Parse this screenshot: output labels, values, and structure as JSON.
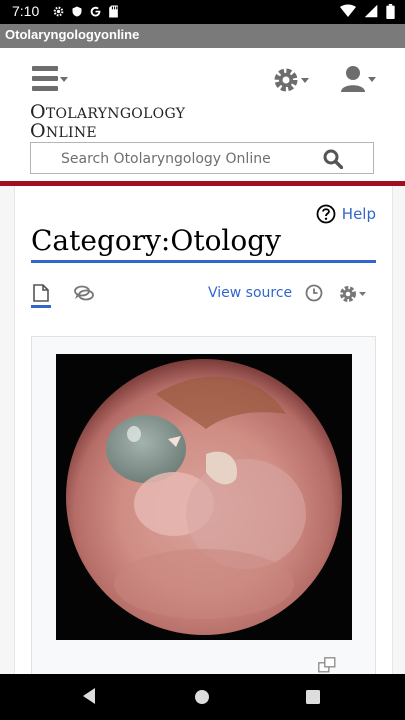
{
  "status_bar": {
    "time": "7:10"
  },
  "app_bar": {
    "title": "Otolaryngologyonline"
  },
  "site": {
    "logo_line1_cap": "O",
    "logo_line1_rest": "TOLARYNGOLOGY",
    "logo_line2_cap": "O",
    "logo_line2_rest": "NLINE",
    "search_placeholder": "Search Otolaryngology Online"
  },
  "page": {
    "help_label": "Help",
    "title": "Category:Otology",
    "view_source_label": "View source"
  },
  "colors": {
    "accent": "#3366cc",
    "brand_rule": "#a00f1e",
    "appbar": "#7a7a7a"
  },
  "icons": [
    "menu-icon",
    "gear-icon",
    "user-icon",
    "search-icon",
    "help-icon",
    "page-icon",
    "talk-icon",
    "history-icon",
    "magnify-icon",
    "back-icon",
    "home-icon",
    "recent-apps-icon"
  ]
}
